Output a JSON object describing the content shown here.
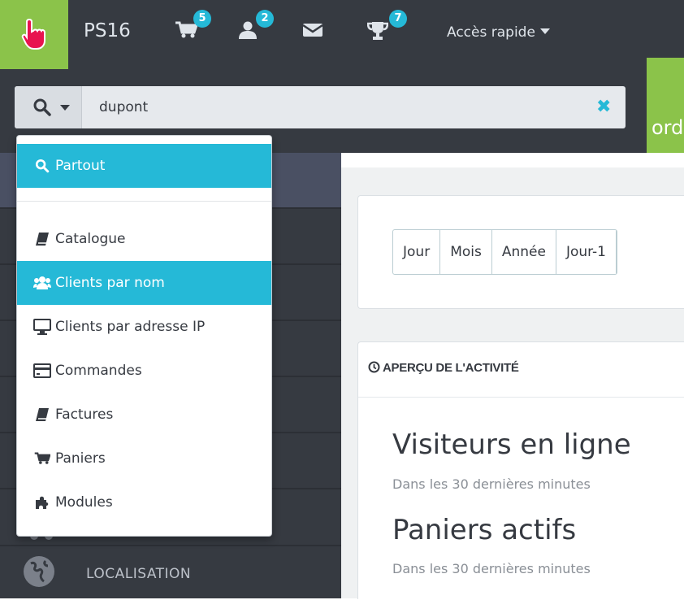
{
  "header": {
    "app_name": "PS16",
    "badges": {
      "cart": "5",
      "customers": "2",
      "trophy": "7"
    },
    "quick_access": "Accès rapide"
  },
  "search": {
    "value": "dupont",
    "clear_icon": "times-icon",
    "type_icon": "search-icon"
  },
  "green_block_text": "ord",
  "search_menu": {
    "items": [
      {
        "label": "Partout",
        "icon": "search-icon"
      },
      {
        "label": "Catalogue",
        "icon": "book-icon"
      },
      {
        "label": "Clients par nom",
        "icon": "users-icon"
      },
      {
        "label": "Clients par adresse IP",
        "icon": "desktop-icon"
      },
      {
        "label": "Commandes",
        "icon": "credit-card-icon"
      },
      {
        "label": "Factures",
        "icon": "book-icon"
      },
      {
        "label": "Paniers",
        "icon": "cart-icon"
      },
      {
        "label": "Modules",
        "icon": "puzzle-icon"
      }
    ]
  },
  "sidebar": {
    "localisation": "LOCALISATION"
  },
  "period_buttons": [
    "Jour",
    "Mois",
    "Année",
    "Jour-1"
  ],
  "activity": {
    "title": "APERÇU DE L'ACTIVITÉ",
    "online_visitors": "Visiteurs en ligne",
    "online_visitors_sub": "Dans les 30 dernières minutes",
    "active_carts": "Paniers actifs",
    "active_carts_sub": "Dans les 30 dernières minutes"
  },
  "colors": {
    "accent": "#25b9d7",
    "brand_green": "#8bc34a",
    "dark": "#363a41"
  }
}
